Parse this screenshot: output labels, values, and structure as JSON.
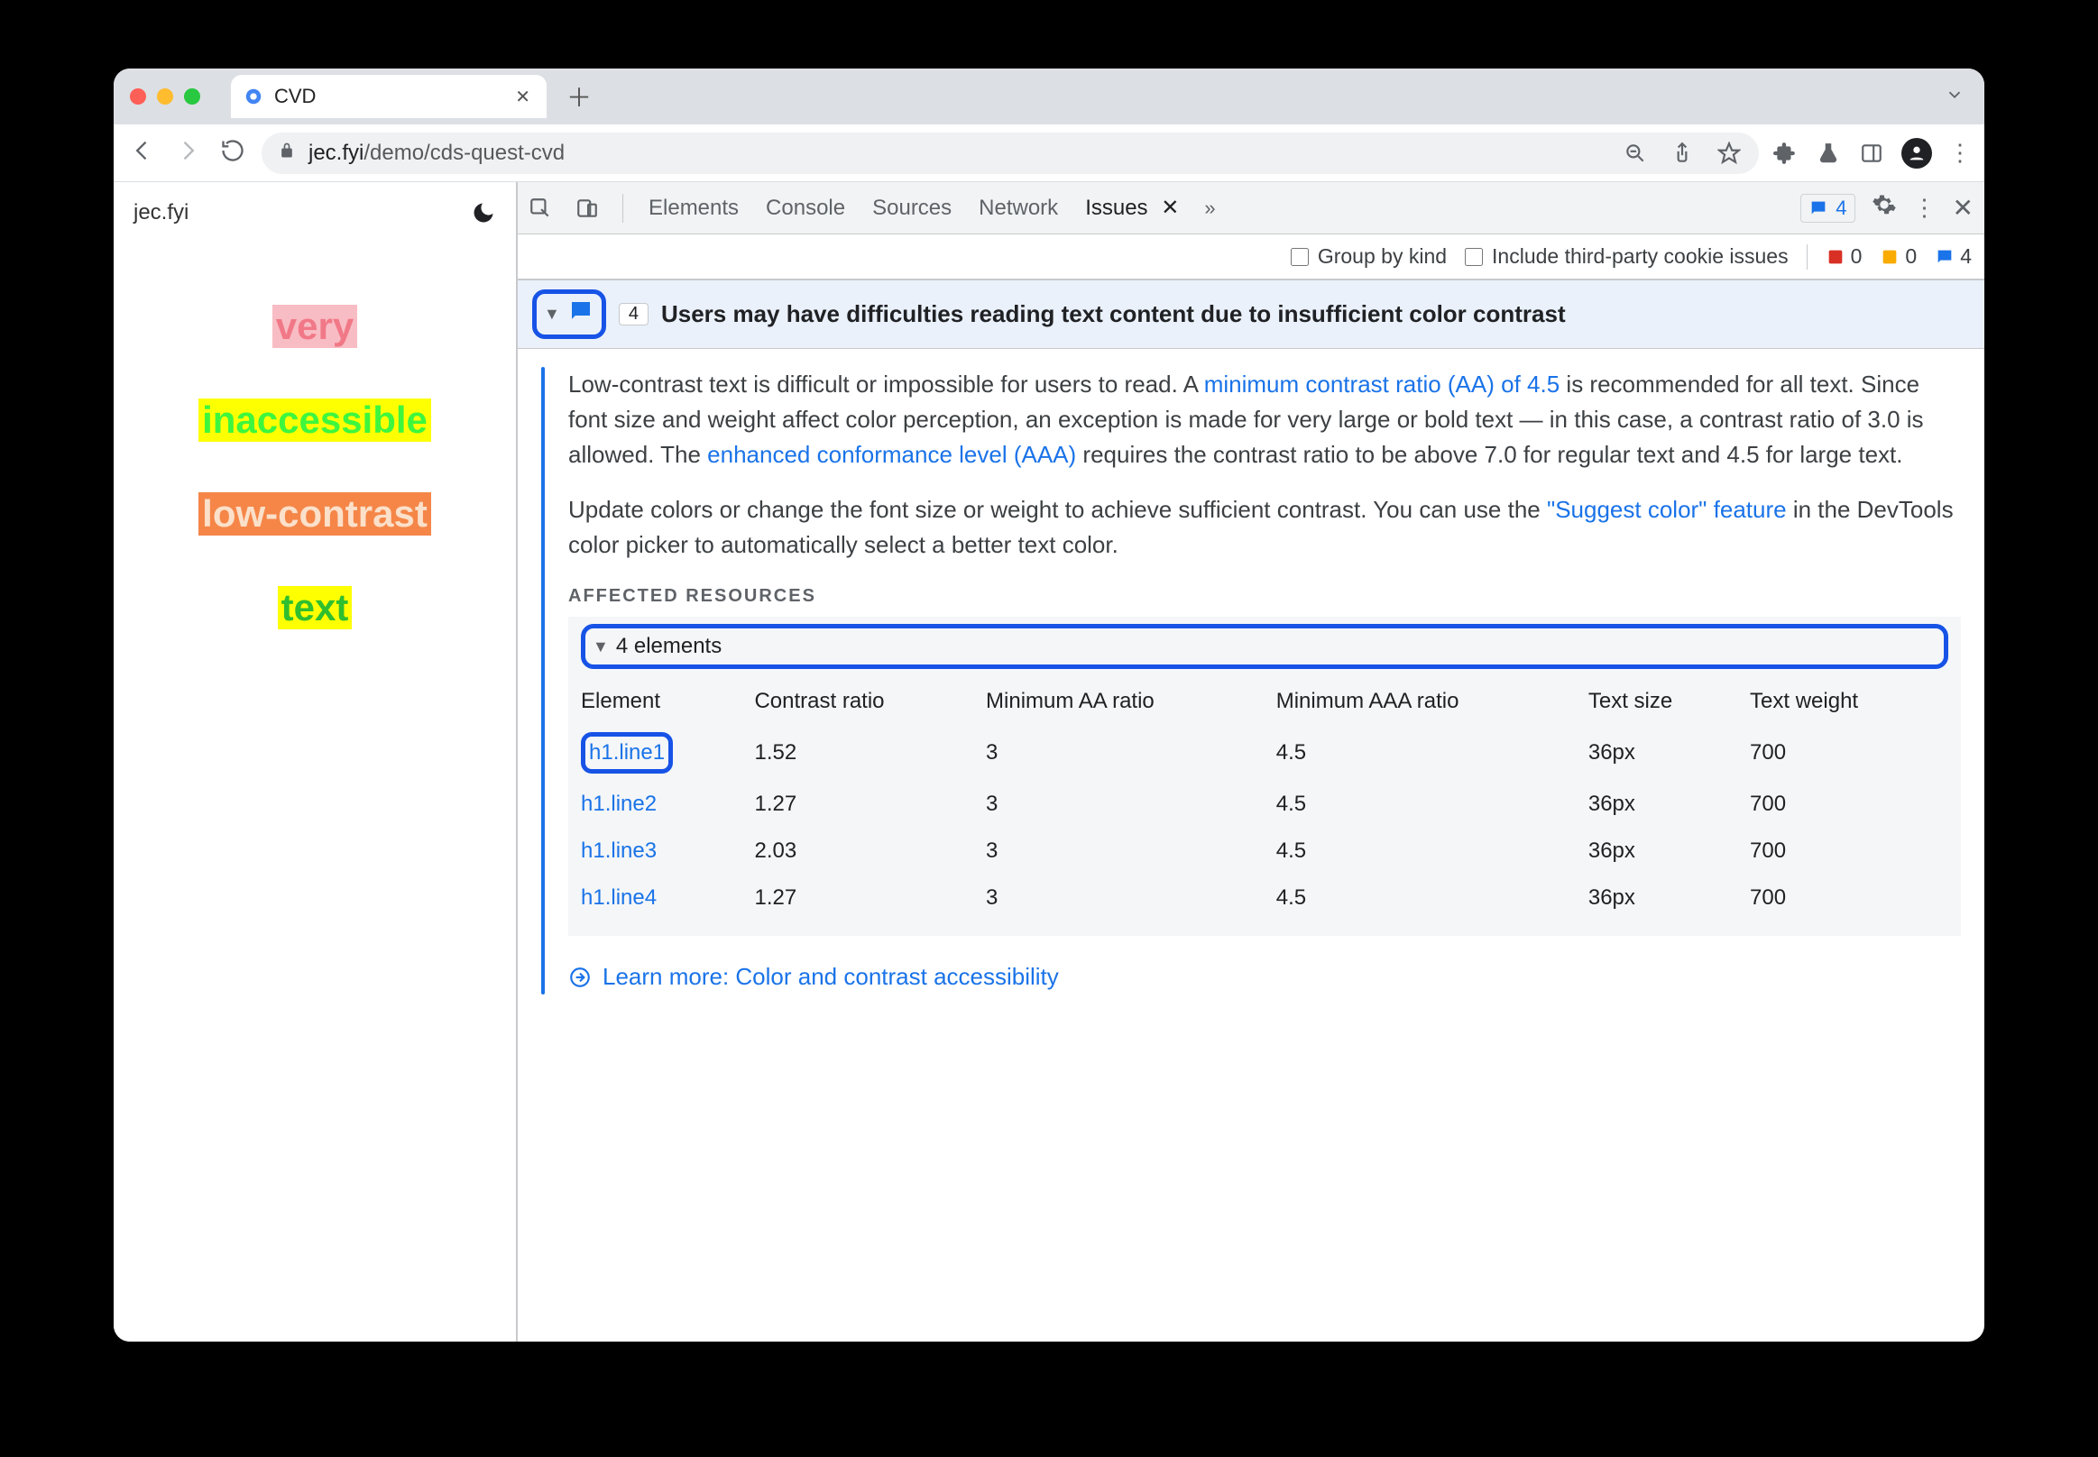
{
  "tab": {
    "title": "CVD"
  },
  "url": {
    "host": "jec.fyi",
    "path": "/demo/cds-quest-cvd"
  },
  "page": {
    "brand": "jec.fyi",
    "words": [
      "very",
      "inaccessible",
      "low-contrast",
      "text"
    ]
  },
  "devtools": {
    "tabs": [
      "Elements",
      "Console",
      "Sources",
      "Network"
    ],
    "activeTab": "Issues",
    "msgCount": "4",
    "subbar": {
      "groupByKind": "Group by kind",
      "thirdParty": "Include third-party cookie issues",
      "counts": {
        "errors": "0",
        "warnings": "0",
        "info": "4"
      }
    }
  },
  "issue": {
    "count": "4",
    "title": "Users may have difficulties reading text content due to insufficient color contrast",
    "p1a": "Low-contrast text is difficult or impossible for users to read. A ",
    "p1link": "minimum contrast ratio (AA) of 4.5",
    "p1b": " is recommended for all text. Since font size and weight affect color perception, an exception is made for very large or bold text — in this case, a contrast ratio of 3.0 is allowed. The ",
    "p1link2": "enhanced conformance level (AAA)",
    "p1c": " requires the contrast ratio to be above 7.0 for regular text and 4.5 for large text.",
    "p2a": "Update colors or change the font size or weight to achieve sufficient contrast. You can use the ",
    "p2link": "\"Suggest color\" feature",
    "p2b": " in the DevTools color picker to automatically select a better text color.",
    "affectedHeading": "AFFECTED RESOURCES",
    "elementsToggle": "4 elements",
    "columns": [
      "Element",
      "Contrast ratio",
      "Minimum AA ratio",
      "Minimum AAA ratio",
      "Text size",
      "Text weight"
    ],
    "rows": [
      {
        "el": "h1.line1",
        "cr": "1.52",
        "aa": "3",
        "aaa": "4.5",
        "size": "36px",
        "weight": "700"
      },
      {
        "el": "h1.line2",
        "cr": "1.27",
        "aa": "3",
        "aaa": "4.5",
        "size": "36px",
        "weight": "700"
      },
      {
        "el": "h1.line3",
        "cr": "2.03",
        "aa": "3",
        "aaa": "4.5",
        "size": "36px",
        "weight": "700"
      },
      {
        "el": "h1.line4",
        "cr": "1.27",
        "aa": "3",
        "aaa": "4.5",
        "size": "36px",
        "weight": "700"
      }
    ],
    "learnMore": "Learn more: Color and contrast accessibility"
  }
}
